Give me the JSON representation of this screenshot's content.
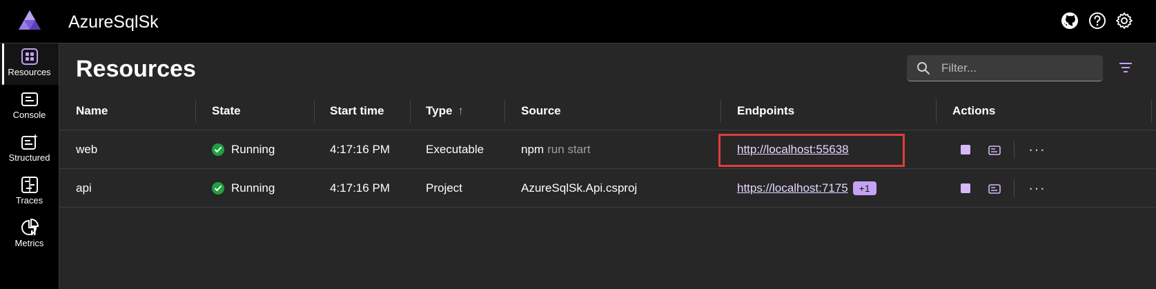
{
  "app": {
    "title": "AzureSqlSk"
  },
  "topbar": {
    "icons": [
      "github-icon",
      "help-icon",
      "settings-icon"
    ]
  },
  "nav": {
    "items": [
      {
        "label": "Resources",
        "icon": "grid-icon",
        "active": true
      },
      {
        "label": "Console",
        "icon": "console-icon",
        "active": false
      },
      {
        "label": "Structured",
        "icon": "structured-logs-icon",
        "active": false
      },
      {
        "label": "Traces",
        "icon": "traces-icon",
        "active": false
      },
      {
        "label": "Metrics",
        "icon": "metrics-icon",
        "active": false
      }
    ]
  },
  "page": {
    "title": "Resources",
    "filter_placeholder": "Filter..."
  },
  "table": {
    "columns": [
      "Name",
      "State",
      "Start time",
      "Type",
      "Source",
      "Endpoints",
      "Actions"
    ],
    "sort_arrow": "↑",
    "rows": [
      {
        "name": "web",
        "state": "Running",
        "start_time": "4:17:16 PM",
        "type": "Executable",
        "source": "npm",
        "source_args": "run start",
        "endpoint": "http://localhost:55638",
        "endpoint_badge": "",
        "highlighted": true
      },
      {
        "name": "api",
        "state": "Running",
        "start_time": "4:17:16 PM",
        "type": "Project",
        "source": "AzureSqlSk.Api.csproj",
        "source_args": "",
        "endpoint": "https://localhost:7175",
        "endpoint_badge": "+1",
        "highlighted": false
      }
    ],
    "actions_more": "···"
  },
  "colors": {
    "accent": "#c4a2f5",
    "running": "#20a040",
    "highlight": "#e23c3c",
    "background": "#272727"
  }
}
